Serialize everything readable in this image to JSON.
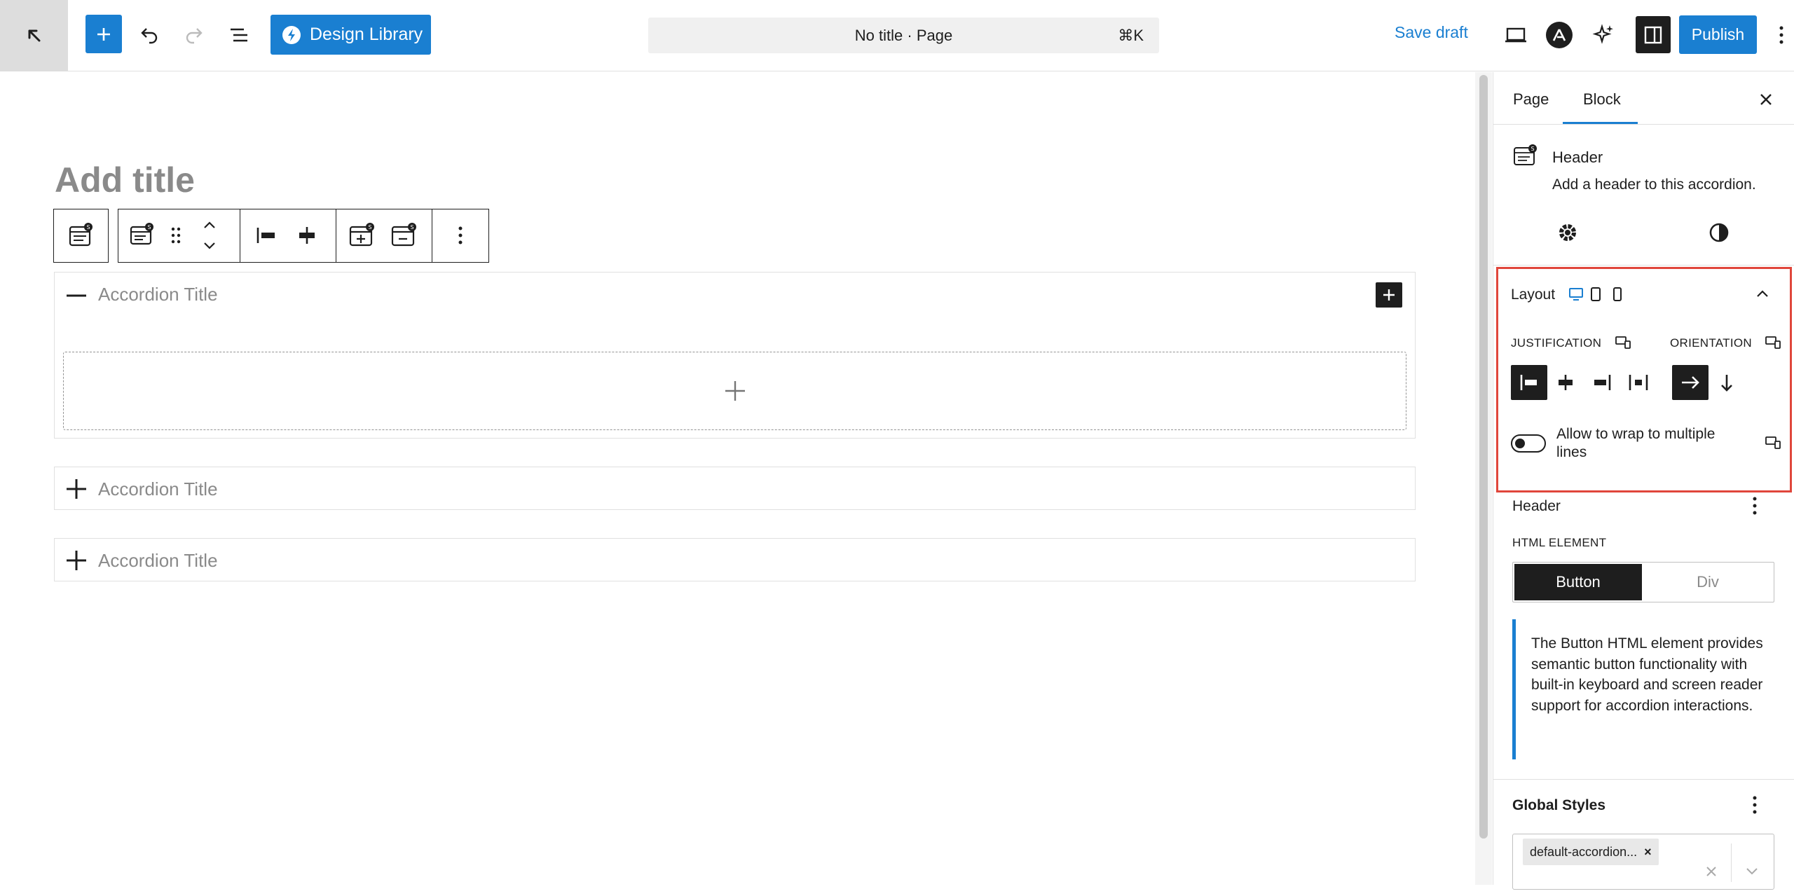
{
  "topbar": {
    "design_library_label": "Design Library",
    "command_text": "No title · Page",
    "command_shortcut": "⌘K",
    "save_draft_label": "Save draft",
    "publish_label": "Publish"
  },
  "editor": {
    "title_placeholder": "Add title"
  },
  "accordions": [
    {
      "title": "Accordion Title",
      "expanded": true
    },
    {
      "title": "Accordion Title",
      "expanded": false
    },
    {
      "title": "Accordion Title",
      "expanded": false
    }
  ],
  "sidebar": {
    "tabs": [
      {
        "label": "Page"
      },
      {
        "label": "Block",
        "active": true
      }
    ],
    "block_card": {
      "title": "Header",
      "description": "Add a header to this accordion."
    },
    "layout": {
      "heading": "Layout",
      "justification_label": "JUSTIFICATION",
      "orientation_label": "ORIENTATION",
      "wrap_label": "Allow to wrap to multiple lines",
      "wrap_enabled": false
    },
    "header_section": {
      "heading": "Header",
      "html_element_label": "HTML ELEMENT",
      "options": [
        "Button",
        "Div"
      ],
      "selected": "Button",
      "note": "The Button HTML element provides semantic button functionality with built-in keyboard and screen reader support for accordion interactions."
    },
    "global_styles": {
      "heading": "Global Styles",
      "chip_label": "default-accordion...",
      "chip_remove": "×"
    }
  },
  "colors": {
    "accent": "#1a7fd1",
    "highlight": "#e0463b",
    "dark": "#1e1e1e"
  }
}
